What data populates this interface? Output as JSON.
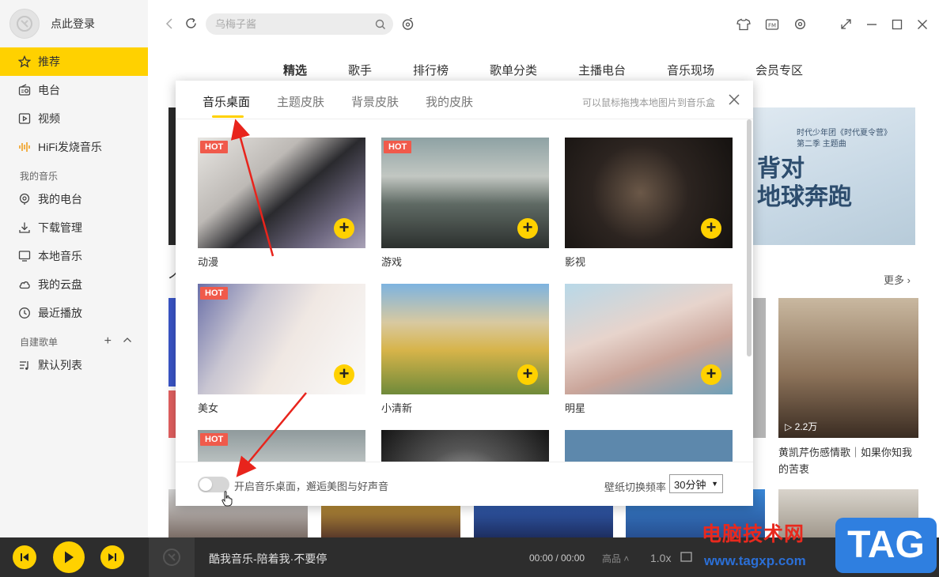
{
  "sidebar": {
    "login_text": "点此登录",
    "nav": [
      {
        "label": "推荐",
        "icon": "star-icon",
        "active": true
      },
      {
        "label": "电台",
        "icon": "radio-icon"
      },
      {
        "label": "视频",
        "icon": "video-icon"
      },
      {
        "label": "HiFi发烧音乐",
        "icon": "hifi-icon"
      }
    ],
    "my_music_title": "我的音乐",
    "my_music": [
      {
        "label": "我的电台",
        "icon": "my-radio-icon"
      },
      {
        "label": "下载管理",
        "icon": "download-icon"
      },
      {
        "label": "本地音乐",
        "icon": "monitor-icon"
      },
      {
        "label": "我的云盘",
        "icon": "cloud-icon"
      },
      {
        "label": "最近播放",
        "icon": "clock-icon"
      }
    ],
    "custom_title": "自建歌单",
    "playlists": [
      {
        "label": "默认列表",
        "icon": "list-icon"
      }
    ]
  },
  "topbar": {
    "search_placeholder": "乌梅子酱"
  },
  "category_tabs": [
    "精选",
    "歌手",
    "排行榜",
    "歌单分类",
    "主播电台",
    "音乐现场",
    "会员专区"
  ],
  "background": {
    "banner_small": "时代少年团《时代夏令营》\n第二季 主题曲",
    "banner_big": "背对\n地球奔跑",
    "heading_fragment": "个",
    "more": "更多",
    "card_play_count": "2.2万",
    "card_title": "黄凯芹伤感情歌｜如果你知我的苦衷"
  },
  "dialog": {
    "tabs": [
      "音乐桌面",
      "主题皮肤",
      "背景皮肤",
      "我的皮肤"
    ],
    "hint": "可以鼠标拖拽本地图片到音乐盒",
    "tiles": [
      {
        "label": "动漫",
        "hot": "HOT"
      },
      {
        "label": "游戏",
        "hot": "HOT"
      },
      {
        "label": "影视",
        "hot": ""
      },
      {
        "label": "美女",
        "hot": "HOT"
      },
      {
        "label": "小清新",
        "hot": ""
      },
      {
        "label": "明星",
        "hot": ""
      },
      {
        "label": "",
        "hot": "HOT"
      },
      {
        "label": "",
        "hot": ""
      },
      {
        "label": "",
        "hot": ""
      }
    ],
    "toggle_label": "开启音乐桌面，邂逅美图与好声音",
    "toggle_on": false,
    "freq_label": "壁纸切换频率",
    "freq_value": "30分钟"
  },
  "player": {
    "song": "酷我音乐-陪着我·不要停",
    "time": "00:00 / 00:00",
    "quality": "高品",
    "speed": "1.0x"
  },
  "watermark": {
    "site_name": "电脑技术网",
    "url": "www.tagxp.com",
    "logo": "TAG"
  }
}
